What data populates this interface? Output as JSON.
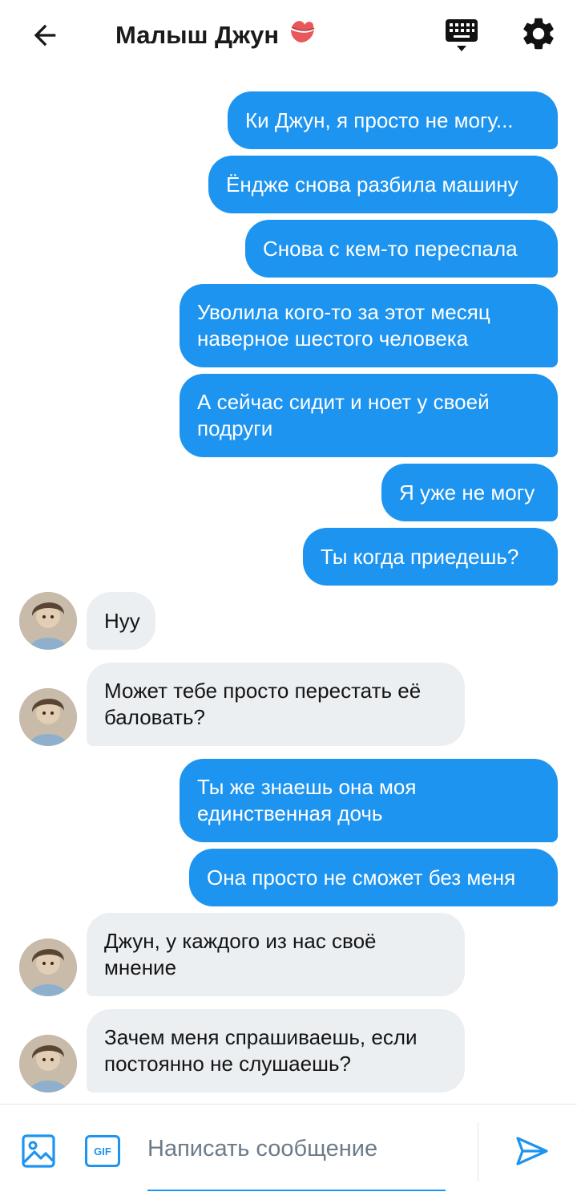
{
  "header": {
    "title": "Малыш Джун",
    "title_emoji": "💋"
  },
  "colors": {
    "accent": "#1d94f0",
    "incoming_bubble": "#eceff2",
    "outgoing_text": "#ffffff"
  },
  "messages": [
    {
      "side": "out",
      "text": "Ки Джун, я просто не могу..."
    },
    {
      "side": "out",
      "text": "Ёндже снова разбила машину"
    },
    {
      "side": "out",
      "text": "Снова с кем-то переспала"
    },
    {
      "side": "out",
      "text": "Уволила кого-то за этот месяц наверное шестого человека"
    },
    {
      "side": "out",
      "text": "А сейчас сидит и ноет у своей подруги"
    },
    {
      "side": "out",
      "text": "Я уже не могу"
    },
    {
      "side": "out",
      "text": "Ты когда приедешь?"
    },
    {
      "side": "in",
      "text": "Нуу"
    },
    {
      "side": "in",
      "text": "Может тебе просто перестать её баловать?"
    },
    {
      "side": "out",
      "text": "Ты же знаешь она моя единственная дочь"
    },
    {
      "side": "out",
      "text": "Она просто не сможет без меня"
    },
    {
      "side": "in",
      "text": "Джун, у каждого из нас своё мнение"
    },
    {
      "side": "in",
      "text": "Зачем меня спрашиваешь, если постоянно не слушаешь?"
    }
  ],
  "composer": {
    "placeholder": "Написать сообщение",
    "gif_label": "GIF"
  }
}
